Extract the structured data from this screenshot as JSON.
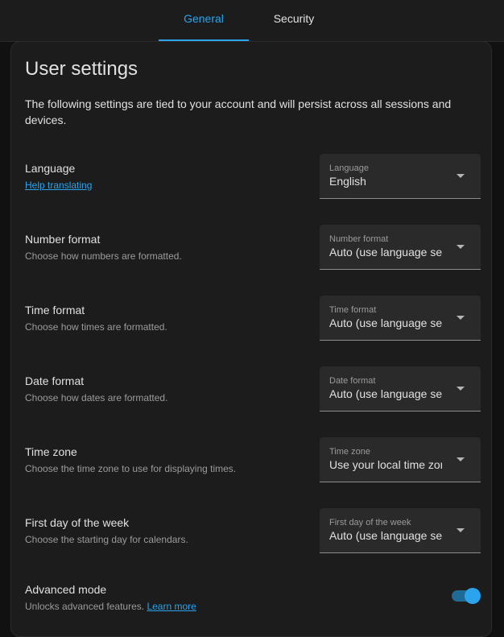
{
  "tabs": {
    "general": "General",
    "security": "Security"
  },
  "card": {
    "title": "User settings",
    "description": "The following settings are tied to your account and will persist across all sessions and devices."
  },
  "language": {
    "label": "Language",
    "help_link": "Help translating",
    "select_label": "Language",
    "value": "English"
  },
  "number_format": {
    "label": "Number format",
    "description": "Choose how numbers are formatted.",
    "select_label": "Number format",
    "value": "Auto (use language setting)"
  },
  "time_format": {
    "label": "Time format",
    "description": "Choose how times are formatted.",
    "select_label": "Time format",
    "value": "Auto (use language setting)"
  },
  "date_format": {
    "label": "Date format",
    "description": "Choose how dates are formatted.",
    "select_label": "Date format",
    "value": "Auto (use language setting)"
  },
  "time_zone": {
    "label": "Time zone",
    "description": "Choose the time zone to use for displaying times.",
    "select_label": "Time zone",
    "value": "Use your local time zone"
  },
  "first_day": {
    "label": "First day of the week",
    "description": "Choose the starting day for calendars.",
    "select_label": "First day of the week",
    "value": "Auto (use language setting)"
  },
  "advanced_mode": {
    "label": "Advanced mode",
    "description": "Unlocks advanced features.",
    "learn_more": "Learn more",
    "enabled": true
  },
  "colors": {
    "accent": "#2ba4ed",
    "background": "#111111",
    "card": "#1c1c1c",
    "field": "#2a2a2a"
  }
}
